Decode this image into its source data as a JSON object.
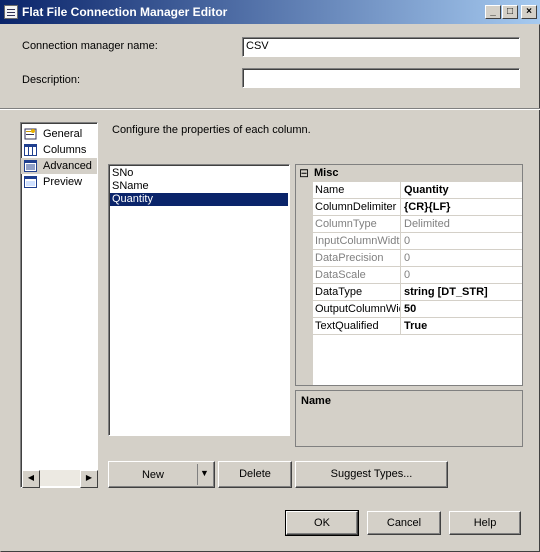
{
  "window": {
    "title": "Flat File Connection Manager Editor",
    "controls": {
      "minimize": "_",
      "maximize": "□",
      "close": "×"
    }
  },
  "connection_name": {
    "label": "Connection manager name:",
    "value": "CSV"
  },
  "description": {
    "label": "Description:",
    "value": ""
  },
  "nav": {
    "items": [
      {
        "label": "General",
        "icon": "general-icon"
      },
      {
        "label": "Columns",
        "icon": "columns-icon"
      },
      {
        "label": "Advanced",
        "icon": "advanced-icon",
        "selected": true
      },
      {
        "label": "Preview",
        "icon": "preview-icon"
      }
    ]
  },
  "main": {
    "instruction": "Configure the properties of each column.",
    "columns": [
      "SNo",
      "SName",
      "Quantity"
    ],
    "selected_column": "Quantity"
  },
  "properties": {
    "category": "Misc",
    "collapse_glyph": "⊟",
    "rows": [
      {
        "name": "Name",
        "value": "Quantity",
        "state": "bold"
      },
      {
        "name": "ColumnDelimiter",
        "value": "{CR}{LF}",
        "state": "bold"
      },
      {
        "name": "ColumnType",
        "value": "Delimited",
        "state": "disabled"
      },
      {
        "name": "InputColumnWidth",
        "value": "0",
        "state": "disabled"
      },
      {
        "name": "DataPrecision",
        "value": "0",
        "state": "disabled"
      },
      {
        "name": "DataScale",
        "value": "0",
        "state": "disabled"
      },
      {
        "name": "DataType",
        "value": "string [DT_STR]",
        "state": "bold"
      },
      {
        "name": "OutputColumnWidth",
        "value": "50",
        "state": "bold"
      },
      {
        "name": "TextQualified",
        "value": "True",
        "state": "bold"
      }
    ],
    "description_title": "Name"
  },
  "buttons": {
    "new": "New",
    "delete": "Delete",
    "suggest": "Suggest Types...",
    "ok": "OK",
    "cancel": "Cancel",
    "help": "Help"
  },
  "colors": {
    "title_start": "#0a246a",
    "title_end": "#a6caf0",
    "selection": "#0a246a",
    "face": "#d4d0c8"
  }
}
